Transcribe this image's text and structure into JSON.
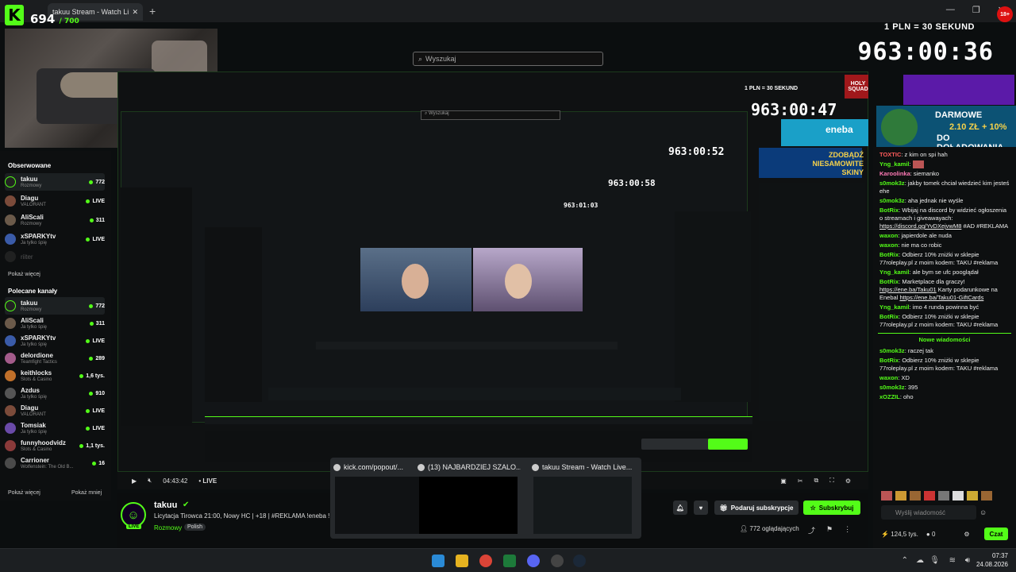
{
  "browser": {
    "tab_title": "takuu Stream - Watch Live on K",
    "new_tab": "+",
    "controls": [
      "—",
      "❐",
      "✕"
    ]
  },
  "overlay": {
    "kick_logo": "K",
    "counter_value": "694",
    "counter_max": "/ 700",
    "rate": "1 PLN = 30 SEKUND",
    "timer": "963:00:36",
    "badge": "18+",
    "promo": {
      "line1": "DARMOWE",
      "amount": "2.10 ZŁ + 10%",
      "line3": "DO DOŁADOWANIA"
    }
  },
  "search": {
    "placeholder": "Wyszukaj"
  },
  "sidebar": {
    "followed_header": "Obserwowane",
    "followed": [
      {
        "name": "takuu",
        "category": "Rozmowy",
        "status": "772"
      },
      {
        "name": "Diagu",
        "category": "VALORANT",
        "status": "LIVE"
      },
      {
        "name": "AliScali",
        "category": "Rozmowy",
        "status": "311"
      },
      {
        "name": "xSPARKYtv",
        "category": "Ja tylko śpię",
        "status": "LIVE"
      },
      {
        "name": "riiter",
        "category": "",
        "status": ""
      }
    ],
    "show_more": "Pokaż więcej",
    "recommended_header": "Polecane kanały",
    "recommended": [
      {
        "name": "takuu",
        "category": "Rozmowy",
        "status": "772"
      },
      {
        "name": "AliScali",
        "category": "Ja tylko śpię",
        "status": "311"
      },
      {
        "name": "xSPARKYtv",
        "category": "Ja tylko śpię",
        "status": "LIVE"
      },
      {
        "name": "delordione",
        "category": "Teamfight Tactics",
        "status": "289"
      },
      {
        "name": "keithlocks",
        "category": "Slots & Casino",
        "status": "1,6 tys."
      },
      {
        "name": "Azdus",
        "category": "Ja tylko śpię",
        "status": "910"
      },
      {
        "name": "Diagu",
        "category": "VALORANT",
        "status": "LIVE"
      },
      {
        "name": "Tomsiak",
        "category": "Ja tylko śpię",
        "status": "LIVE"
      },
      {
        "name": "funnyhoodvidz",
        "category": "Slots & Casino",
        "status": "1,1 tys."
      },
      {
        "name": "Carrioner",
        "category": "Wolfenstein: The Old B...",
        "status": "16"
      }
    ],
    "show_more2": "Pokaż więcej",
    "show_less": "Pokaż mniej"
  },
  "nested": {
    "timers": [
      "963:00:47",
      "963:00:52",
      "963:00:58",
      "963:01:03"
    ],
    "rate2": "1 PLN = 30 SEKUND",
    "promo_text": "ZDOBĄDŹ NIESAMOWITE SKINY",
    "holy": "HOLY SQUAD",
    "eneba": "eneba",
    "darmowe": "DARMOWE"
  },
  "player": {
    "time": "04:43:42",
    "live": "LIVE"
  },
  "stream": {
    "name": "takuu",
    "title": "Licytacja Tirowca 21:00, Nowy HC | +18 | #REKLAMA !eneba !",
    "category": "Rozmowy",
    "language": "Polish",
    "gift_label": "Podaruj subskrypcje",
    "sub_label": "Subskrybuj",
    "viewers": "772 oglądających",
    "live_tag": "LIVE"
  },
  "chat": {
    "messages": [
      {
        "user": "TOXTIC",
        "text": ": z kim on spi hah",
        "color": "r"
      },
      {
        "user": "Yng_kamil",
        "text": ":",
        "color": "g"
      },
      {
        "user": "Karoolinka",
        "text": ": siemanko",
        "color": "p"
      },
      {
        "user": "s0mok3z",
        "text": ": jakby tomek chciał wiedzieć kim jesteś ehe",
        "color": "g"
      },
      {
        "user": "s0mok3z",
        "text": ": aha jednak nie wyśle",
        "color": "g"
      },
      {
        "user": "BotRix",
        "text": ": Wbijaj na discord by widzieć ogłoszenia o streamach i giveawayach:",
        "link": "https://discord.gg/YvDXejvwM8",
        "tail": " #AD #REKLAMA",
        "color": "b"
      },
      {
        "user": "waxon",
        "text": ": japierdole ale nuda",
        "color": "g"
      },
      {
        "user": "waxon",
        "text": ": nie ma co robic",
        "color": "g"
      },
      {
        "user": "BotRix",
        "text": ": Odbierz 10% zniżki w sklepie 77roleplay.pl z moim kodem: TAKU #reklama",
        "color": "b"
      },
      {
        "user": "Yng_kamil",
        "text": ": ale bym se ufc pooglądał",
        "color": "g"
      },
      {
        "user": "BotRix",
        "text": ": Marketplace dla graczy!",
        "link": "https://ene.ba/Taku01",
        "tail": " Karty podarunkowe na Enebal",
        "link2": "https://ene.ba/Taku01-GiftCards",
        "color": "b"
      },
      {
        "user": "Yng_kamil",
        "text": ": imo 4 runda powinna być",
        "color": "g"
      },
      {
        "user": "BotRix",
        "text": ": Odbierz 10% zniżki w sklepie 77roleplay.pl z moim kodem: TAKU #reklama",
        "color": "b"
      }
    ],
    "new_messages": "Nowe wiadomości",
    "messages2": [
      {
        "user": "s0mok3z",
        "text": ": raczej tak",
        "color": "g"
      },
      {
        "user": "BotRix",
        "text": ": Odbierz 10% zniżki w sklepie 77roleplay.pl z moim kodem: TAKU #reklama",
        "color": "b"
      },
      {
        "user": "waxon",
        "text": ": XD",
        "color": "g"
      },
      {
        "user": "s0mok3z",
        "text": ": 395",
        "color": "g"
      },
      {
        "user": "xOZZIL",
        "text": ": oho",
        "color": "g"
      }
    ],
    "input_placeholder": "Wyślij wiadomość",
    "points": "124,5 tys.",
    "zero": "0",
    "send": "Czat"
  },
  "thumbs": [
    {
      "title": "kick.com/popout/..."
    },
    {
      "title": "(13) NAJBARDZIEJ SZALO..."
    },
    {
      "title": "takuu Stream - Watch Live..."
    }
  ],
  "taskbar": {
    "time": "07:37",
    "date": "24.08.2026"
  }
}
